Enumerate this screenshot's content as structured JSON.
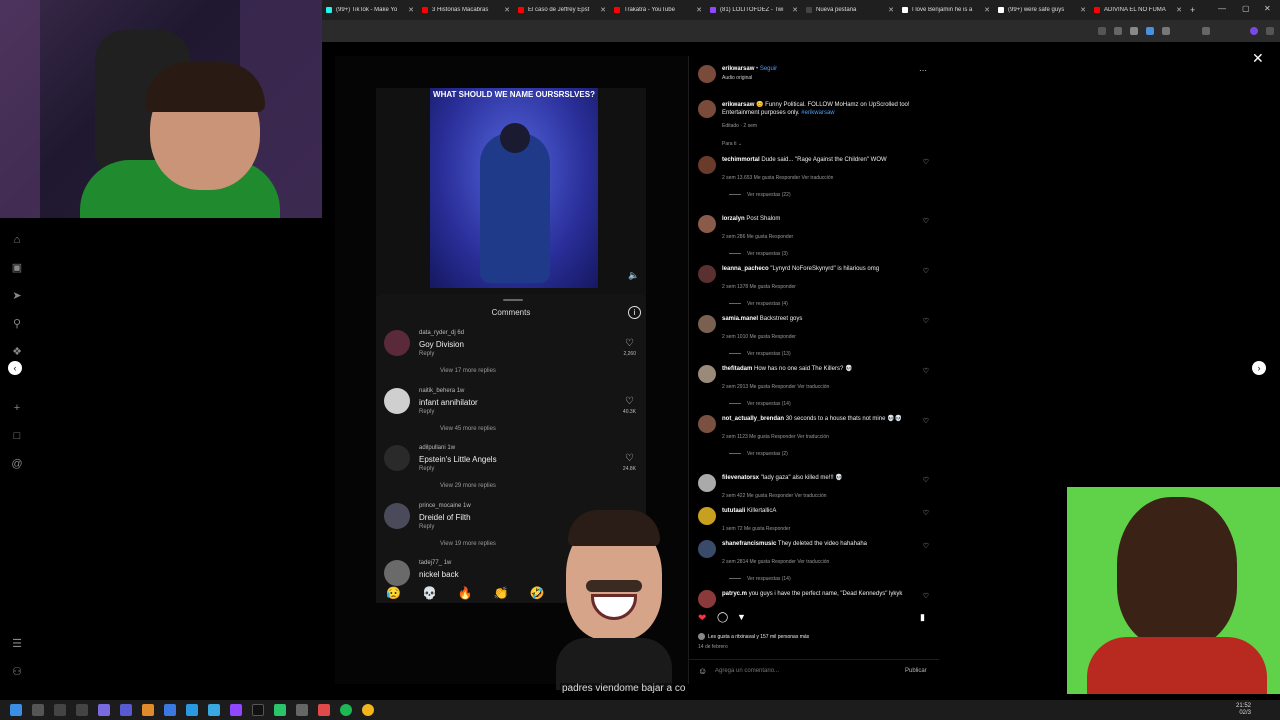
{
  "browser": {
    "tabs": [
      {
        "title": "(99+) TikTok - Make Yo",
        "color": "#25f4ee"
      },
      {
        "title": "3 Historias Macabras",
        "color": "#ff0000"
      },
      {
        "title": "El caso de Jeffrey Epst",
        "color": "#ff0000"
      },
      {
        "title": "Trakatrá - YouTube",
        "color": "#ff0000"
      },
      {
        "title": "(81) LOLITOFDEZ - Twi",
        "color": "#9146ff"
      },
      {
        "title": "Nueva pestaña",
        "color": "#444444"
      },
      {
        "title": "I love Benjamin he is a",
        "color": "#ffffff"
      },
      {
        "title": "(99+) were safe guys",
        "color": "#ffffff"
      },
      {
        "title": "ADIVINA EL NO FUMA",
        "color": "#ff0000"
      }
    ]
  },
  "tiktok_clip": {
    "title": "WHAT SHOULD WE NAME OURSRSLVES?"
  },
  "tiktok_comments": {
    "title": "Comments",
    "reply_label": "Reply",
    "items": [
      {
        "user": "data_ryder_dj",
        "age": "6d",
        "text": "Goy Division",
        "likes": "2,260",
        "view": "View 17 more replies"
      },
      {
        "user": "naitik_behera",
        "age": "1w",
        "text": "infant annihilator",
        "likes": "40.3K",
        "view": "View 45 more replies"
      },
      {
        "user": "adilpullani",
        "age": "1w",
        "text": "Epstein's Little Angels",
        "likes": "24.8K",
        "view": "View 29 more replies"
      },
      {
        "user": "prince_mocaine",
        "age": "1w",
        "text": "Dreidel of Filth",
        "likes": "",
        "view": "View 19 more replies"
      },
      {
        "user": "tadej77_",
        "age": "1w",
        "text": "nickel back",
        "likes": "",
        "view": ""
      }
    ],
    "emojis": [
      "😥",
      "💀",
      "🔥",
      "👏",
      "🤣",
      "😮"
    ]
  },
  "instagram": {
    "author": "erikwarsaw",
    "follow": "Seguir",
    "audio": "Audio original",
    "caption_user": "erikwarsaw",
    "caption_text": "😊 Funny Political. FOLLOW MoHamz on UpScrolled too! Entertainment purposes only.",
    "caption_tag": "#erikwarsaw",
    "caption_meta": "Editado · 2 sem",
    "for_you": "Para ti",
    "comments": [
      {
        "user": "techimmortal",
        "text": "Dude said... \"Rage Against the Children\" WOW",
        "meta": "2 sem   13.653 Me gusta   Responder   Ver traducción",
        "view": "Ver respuestas (22)"
      },
      {
        "user": "lorzalyn",
        "text": "Post Shalom",
        "meta": "2 sem   286 Me gusta   Responder",
        "view": "Ver respuestas (3)"
      },
      {
        "user": "leanna_pacheco",
        "text": "\"Lynyrd NoForeSkynyrd\" is hilarious omg",
        "meta": "2 sem   1378 Me gusta   Responder",
        "view": "Ver respuestas (4)"
      },
      {
        "user": "samia.manel",
        "text": "Backstreet goys",
        "meta": "2 sem   1010 Me gusta   Responder",
        "view": "Ver respuestas (13)"
      },
      {
        "user": "thefitadam",
        "text": "How has no one said The Killers? 💀",
        "meta": "2 sem   2913 Me gusta   Responder   Ver traducción",
        "view": "Ver respuestas (14)"
      },
      {
        "user": "not_actually_brendan",
        "text": "30 seconds to a house thats not mine 💀💀",
        "meta": "2 sem   1123 Me gusta   Responder   Ver traducción",
        "view": "Ver respuestas (2)"
      },
      {
        "user": "filevenatorsx",
        "text": "\"lady gaza\" also killed me!!! 💀",
        "meta": "2 sem   422 Me gusta   Responder   Ver traducción",
        "view": ""
      },
      {
        "user": "tututaali",
        "text": "KillertallicA",
        "meta": "1 sem   72 Me gusta   Responder",
        "view": ""
      },
      {
        "user": "shanefrancismusic",
        "text": "They deleted the video hahahaha",
        "meta": "2 sem   2814 Me gusta   Responder   Ver traducción",
        "view": "Ver respuestas (14)"
      },
      {
        "user": "patryc.m",
        "text": "you guys i have the perfect name, \"Dead Kennedys\" lykyk",
        "meta": "",
        "view": ""
      }
    ],
    "likes_text": "Les gusta a ritxinaval y 157 mil personas más",
    "date": "14 de febrero",
    "comment_placeholder": "Agrega un comentario...",
    "publish": "Publicar"
  },
  "subtitle": "padres viendome bajar a co",
  "clock": {
    "time": "21:52",
    "date": "02/3"
  }
}
